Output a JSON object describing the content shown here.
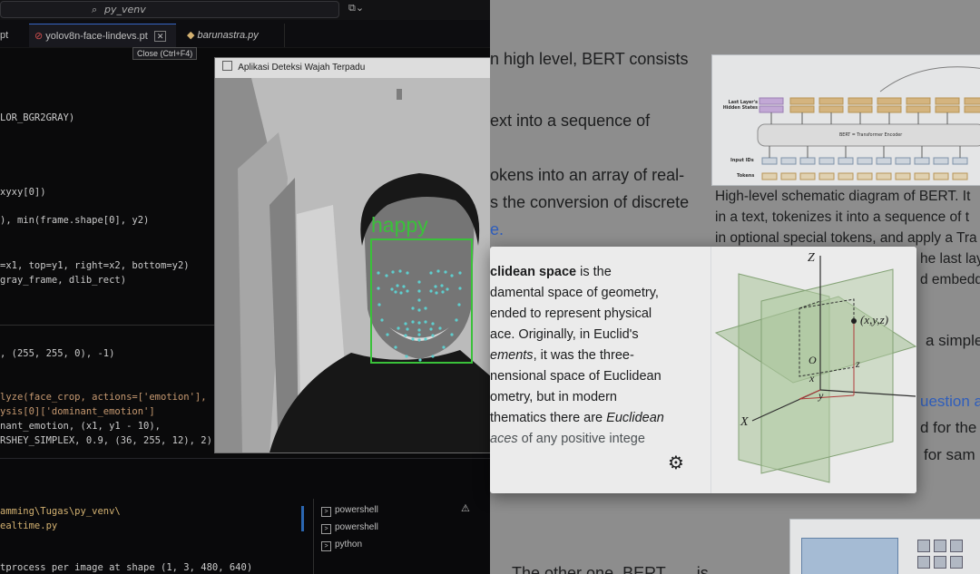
{
  "editor": {
    "search_text": "py_venv",
    "tabs": [
      {
        "label": "pt"
      },
      {
        "label": "yolov8n-face-lindevs.pt",
        "close": "✕"
      },
      {
        "label": "barunastra.py"
      }
    ],
    "tooltip": "Close (Ctrl+F4)",
    "code_lines": [
      {
        "text": "LOR_BGR2GRAY)"
      },
      {
        "text": "xyxy[0])"
      },
      {
        "text": "), min(frame.shape[0], y2)"
      },
      {
        "text": "=x1, top=y1, right=x2, bottom=y2)"
      },
      {
        "text": "gray_frame, dlib_rect)"
      },
      {
        "text": ", (255, 255, 0), -1)"
      },
      {
        "text": "lyze(face_crop, actions=['emotion'],"
      },
      {
        "text": "ysis[0]['dominant_emotion']"
      },
      {
        "text": "nant_emotion, (x1, y1 - 10),"
      },
      {
        "text": "RSHEY_SIMPLEX, 0.9, (36, 255, 12), 2)"
      }
    ],
    "terminal_lines": [
      {
        "text": "amming\\Tugas\\py_venv\\"
      },
      {
        "text": "ealtime.py"
      },
      {
        "text": "tprocess per image at shape (1, 3, 480, 640)"
      }
    ],
    "terminal_list": [
      {
        "label": "powershell"
      },
      {
        "label": "powershell"
      },
      {
        "label": "python"
      }
    ],
    "warning_icon": "⚠"
  },
  "camera": {
    "title": "Aplikasi Deteksi Wajah Terpadu",
    "emotion_label": "happy",
    "box_color": "#3fd23f"
  },
  "wiki": {
    "lines_top": [
      "n high level, BERT consists",
      "ext into a sequence of",
      "okens into an array of real-",
      "s the conversion of discrete",
      "e."
    ],
    "caption_lines": [
      "High-level schematic diagram of BERT. It",
      "in a text, tokenizes it into a sequence of t",
      "in optional special tokens, and apply a Tra",
      "he last lay",
      "d embedd"
    ],
    "right_fragments": [
      "a simple",
      "uestion a",
      "d for the",
      "for sam"
    ],
    "bottom_line": "The other one, BERT",
    "bottom_line2": "is",
    "diagram": {
      "label_last_layer": "Last Layer's Hidden States",
      "label_encoder": "BERT = Transformer Encoder",
      "label_input_ids": "Input IDs",
      "label_tokens": "Tokens"
    }
  },
  "popup": {
    "lines": [
      {
        "bold": "clidean space",
        "rest": " is the"
      },
      {
        "rest": "damental space of geometry,"
      },
      {
        "rest": "ended to represent physical"
      },
      {
        "rest": "ace. Originally, in Euclid's"
      },
      {
        "italic": "ements",
        "rest": ", it was the three-"
      },
      {
        "rest": "nensional space of Euclidean"
      },
      {
        "rest": "ometry, but in modern"
      },
      {
        "rest": "thematics there are ",
        "italic2": "Euclidean"
      },
      {
        "italic": "aces",
        "rest": " of any positive intege"
      }
    ],
    "gear_icon": "⚙",
    "axes": {
      "z": "Z",
      "x": "X",
      "point": "(x,y,z)",
      "origin": "O",
      "lx": "x",
      "ly": "y",
      "lz": "z"
    }
  }
}
